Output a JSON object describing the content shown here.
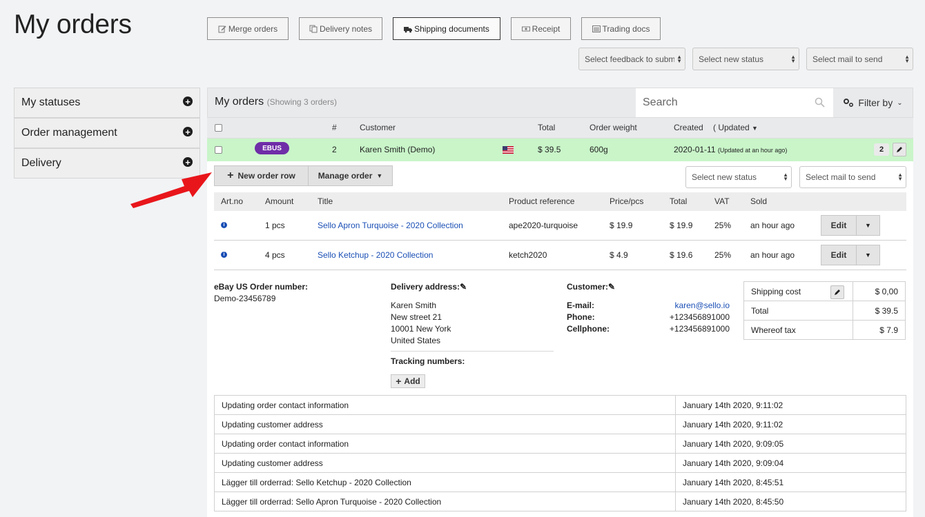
{
  "page": {
    "title": "My orders"
  },
  "toolbar": {
    "buttons": [
      {
        "label": "Merge orders",
        "icon": "edit-icon"
      },
      {
        "label": "Delivery notes",
        "icon": "copy-icon"
      },
      {
        "label": "Shipping documents",
        "icon": "truck-icon"
      },
      {
        "label": "Receipt",
        "icon": "money-icon"
      },
      {
        "label": "Trading docs",
        "icon": "list-icon"
      }
    ],
    "selects": [
      "Select feedback to subm",
      "Select new status",
      "Select mail to send"
    ]
  },
  "sidebar": {
    "items": [
      {
        "label": "My statuses"
      },
      {
        "label": "Order management"
      },
      {
        "label": "Delivery"
      }
    ]
  },
  "orders": {
    "title": "My orders",
    "showing": "(Showing 3 orders)",
    "search_placeholder": "Search",
    "filter_label": "Filter by",
    "columns": {
      "num": "#",
      "customer": "Customer",
      "total": "Total",
      "weight": "Order weight",
      "created": "Created",
      "updated": "( Updated"
    },
    "order": {
      "badge": "EBUS",
      "num": "2",
      "customer": "Karen Smith (Demo)",
      "flag": "us-flag-icon",
      "total": "$ 39.5",
      "weight": "600g",
      "created": "2020-01-11",
      "updated": "(Updated at an hour ago)",
      "count": "2",
      "row_color": "#c9f5c9"
    }
  },
  "order_detail": {
    "new_row_label": "New order row",
    "manage_label": "Manage order",
    "status_select": "Select new status",
    "mail_select": "Select mail to send",
    "item_columns": {
      "artno": "Art.no",
      "amount": "Amount",
      "title": "Title",
      "ref": "Product reference",
      "price": "Price/pcs",
      "total": "Total",
      "vat": "VAT",
      "sold": "Sold"
    },
    "items": [
      {
        "amount": "1 pcs",
        "title": "Sello Apron Turquoise - 2020 Collection",
        "ref": "ape2020-turquoise",
        "price": "$ 19.9",
        "total": "$ 19.9",
        "vat": "25%",
        "sold": "an hour ago",
        "edit": "Edit"
      },
      {
        "amount": "4 pcs",
        "title": "Sello Ketchup - 2020 Collection",
        "ref": "ketch2020",
        "price": "$ 4.9",
        "total": "$ 19.6",
        "vat": "25%",
        "sold": "an hour ago",
        "edit": "Edit"
      }
    ],
    "ebay": {
      "label": "eBay US Order number:",
      "value": "Demo-23456789"
    },
    "delivery": {
      "label": "Delivery address:",
      "lines": [
        "Karen Smith",
        "New street 21",
        "10001 New York",
        "United States"
      ]
    },
    "tracking": {
      "label": "Tracking numbers:",
      "add": "Add"
    },
    "customer": {
      "label": "Customer:",
      "email_label": "E-mail:",
      "email": "karen@sello.io",
      "phone_label": "Phone:",
      "phone": "+123456891000",
      "cell_label": "Cellphone:",
      "cell": "+123456891000"
    },
    "summary": [
      {
        "label": "Shipping cost",
        "value": "$ 0,00"
      },
      {
        "label": "Total",
        "value": "$ 39.5"
      },
      {
        "label": "Whereof tax",
        "value": "$ 7.9"
      }
    ],
    "log": [
      {
        "text": "Updating order contact information",
        "time": "January 14th 2020, 9:11:02"
      },
      {
        "text": "Updating customer address",
        "time": "January 14th 2020, 9:11:02"
      },
      {
        "text": "Updating order contact information",
        "time": "January 14th 2020, 9:09:05"
      },
      {
        "text": "Updating customer address",
        "time": "January 14th 2020, 9:09:04"
      },
      {
        "text": "Lägger till orderrad: Sello Ketchup - 2020 Collection",
        "time": "January 14th 2020, 8:45:51"
      },
      {
        "text": "Lägger till orderrad: Sello Apron Turquoise - 2020 Collection",
        "time": "January 14th 2020, 8:45:50"
      }
    ]
  },
  "annotation": {
    "color": "#e8161b",
    "icon": "red-arrow-icon"
  }
}
